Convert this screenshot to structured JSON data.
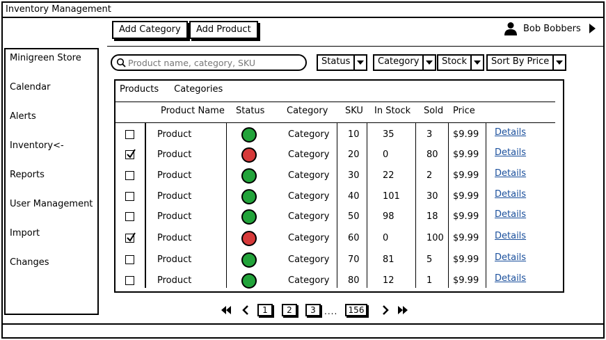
{
  "window": {
    "title": "Inventory Management"
  },
  "toolbar": {
    "add_category": "Add Category",
    "add_product": "Add Product"
  },
  "user": {
    "name": "Bob Bobbers"
  },
  "sidebar": {
    "items": [
      {
        "label": "Minigreen Store"
      },
      {
        "label": "Calendar"
      },
      {
        "label": "Alerts"
      },
      {
        "label": "Inventory<-"
      },
      {
        "label": "Reports"
      },
      {
        "label": "User Management"
      },
      {
        "label": "Import"
      },
      {
        "label": "Changes"
      }
    ]
  },
  "search": {
    "placeholder": "Product name, category, SKU",
    "value": ""
  },
  "filters": {
    "status": "Status",
    "category": "Category",
    "stock": "Stock",
    "sort": "Sort By Price"
  },
  "tabs": {
    "products": "Products",
    "categories": "Categories"
  },
  "table": {
    "headers": {
      "name": "Product Name",
      "status": "Status",
      "category": "Category",
      "sku": "SKU",
      "in_stock": "In Stock",
      "sold": "Sold",
      "price": "Price"
    },
    "status_colors": {
      "green": "#22a33a",
      "red": "#d63a3a"
    },
    "rows": [
      {
        "checked": false,
        "name": "Product",
        "status": "green",
        "category": "Category",
        "sku": "10",
        "in_stock": "35",
        "sold": "3",
        "price": "$9.99",
        "details": "Details"
      },
      {
        "checked": true,
        "name": "Product",
        "status": "red",
        "category": "Category",
        "sku": "20",
        "in_stock": "0",
        "sold": "80",
        "price": "$9.99",
        "details": "Details"
      },
      {
        "checked": false,
        "name": "Product",
        "status": "green",
        "category": "Category",
        "sku": "30",
        "in_stock": "22",
        "sold": "2",
        "price": "$9.99",
        "details": "Details"
      },
      {
        "checked": false,
        "name": "Product",
        "status": "green",
        "category": "Category",
        "sku": "40",
        "in_stock": "101",
        "sold": "30",
        "price": "$9.99",
        "details": "Details"
      },
      {
        "checked": false,
        "name": "Product",
        "status": "green",
        "category": "Category",
        "sku": "50",
        "in_stock": "98",
        "sold": "18",
        "price": "$9.99",
        "details": "Details"
      },
      {
        "checked": true,
        "name": "Product",
        "status": "red",
        "category": "Category",
        "sku": "60",
        "in_stock": "0",
        "sold": "100",
        "price": "$9.99",
        "details": "Details"
      },
      {
        "checked": false,
        "name": "Product",
        "status": "green",
        "category": "Category",
        "sku": "70",
        "in_stock": "81",
        "sold": "5",
        "price": "$9.99",
        "details": "Details"
      },
      {
        "checked": false,
        "name": "Product",
        "status": "green",
        "category": "Category",
        "sku": "80",
        "in_stock": "12",
        "sold": "1",
        "price": "$9.99",
        "details": "Details"
      }
    ]
  },
  "pagination": {
    "pages": [
      "1",
      "2",
      "3"
    ],
    "last_page": "156",
    "ellipsis": "...."
  }
}
